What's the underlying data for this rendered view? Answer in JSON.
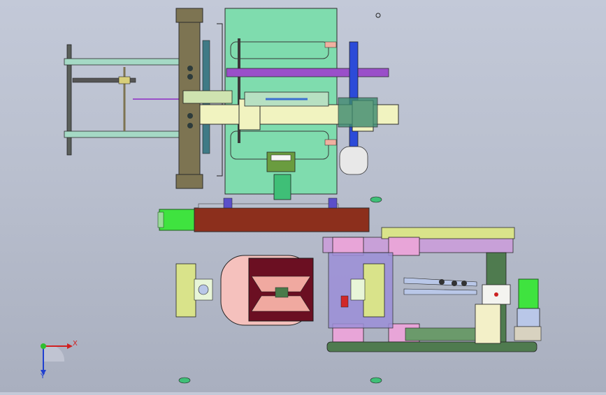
{
  "view": {
    "title": "",
    "axis_x_label": "X",
    "axis_y_label": "Y"
  },
  "colors": {
    "background_top": "#c3c9d8",
    "background_bottom": "#a9afbf",
    "frame_brown": "#7d7452",
    "plate_green": "#7fdcae",
    "motor_green": "#3fe33f",
    "rail_purple": "#9a4fc9",
    "block_pink": "#e8a5d8",
    "block_yellow": "#d9e38a",
    "shaft_cream": "#f1f3c0",
    "tube_brown": "#8c2f1c",
    "base_dark_green": "#4f7b4f",
    "housing_dark_red": "#6b0f22"
  },
  "icons": {
    "view_triad": "xyz-axis-triad-icon"
  }
}
